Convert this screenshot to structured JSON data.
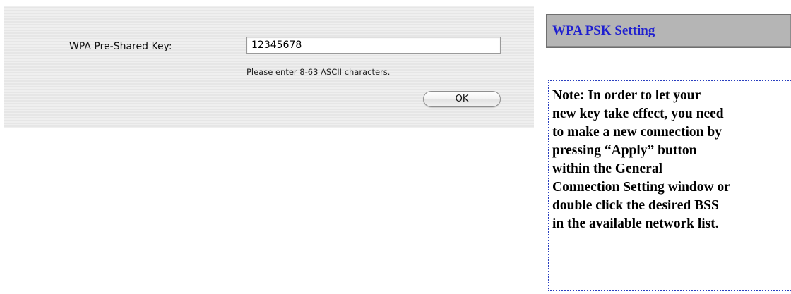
{
  "dialog": {
    "key_label": "WPA Pre-Shared Key:",
    "key_value": "12345678",
    "hint": "Please enter 8-63 ASCII characters.",
    "ok_label": "OK"
  },
  "sidebar": {
    "heading": "WPA PSK Setting",
    "note": "Note:    In order to let your\nnew key take effect, you need\nto make a new connection by\npressing “Apply” button\nwithin the General\nConnection Setting window or\ndouble click the desired BSS\nin the available network list."
  },
  "colors": {
    "heading_text": "#1f1fd0",
    "note_border": "#2a3fc0",
    "heading_background": "#b5b5b5"
  }
}
